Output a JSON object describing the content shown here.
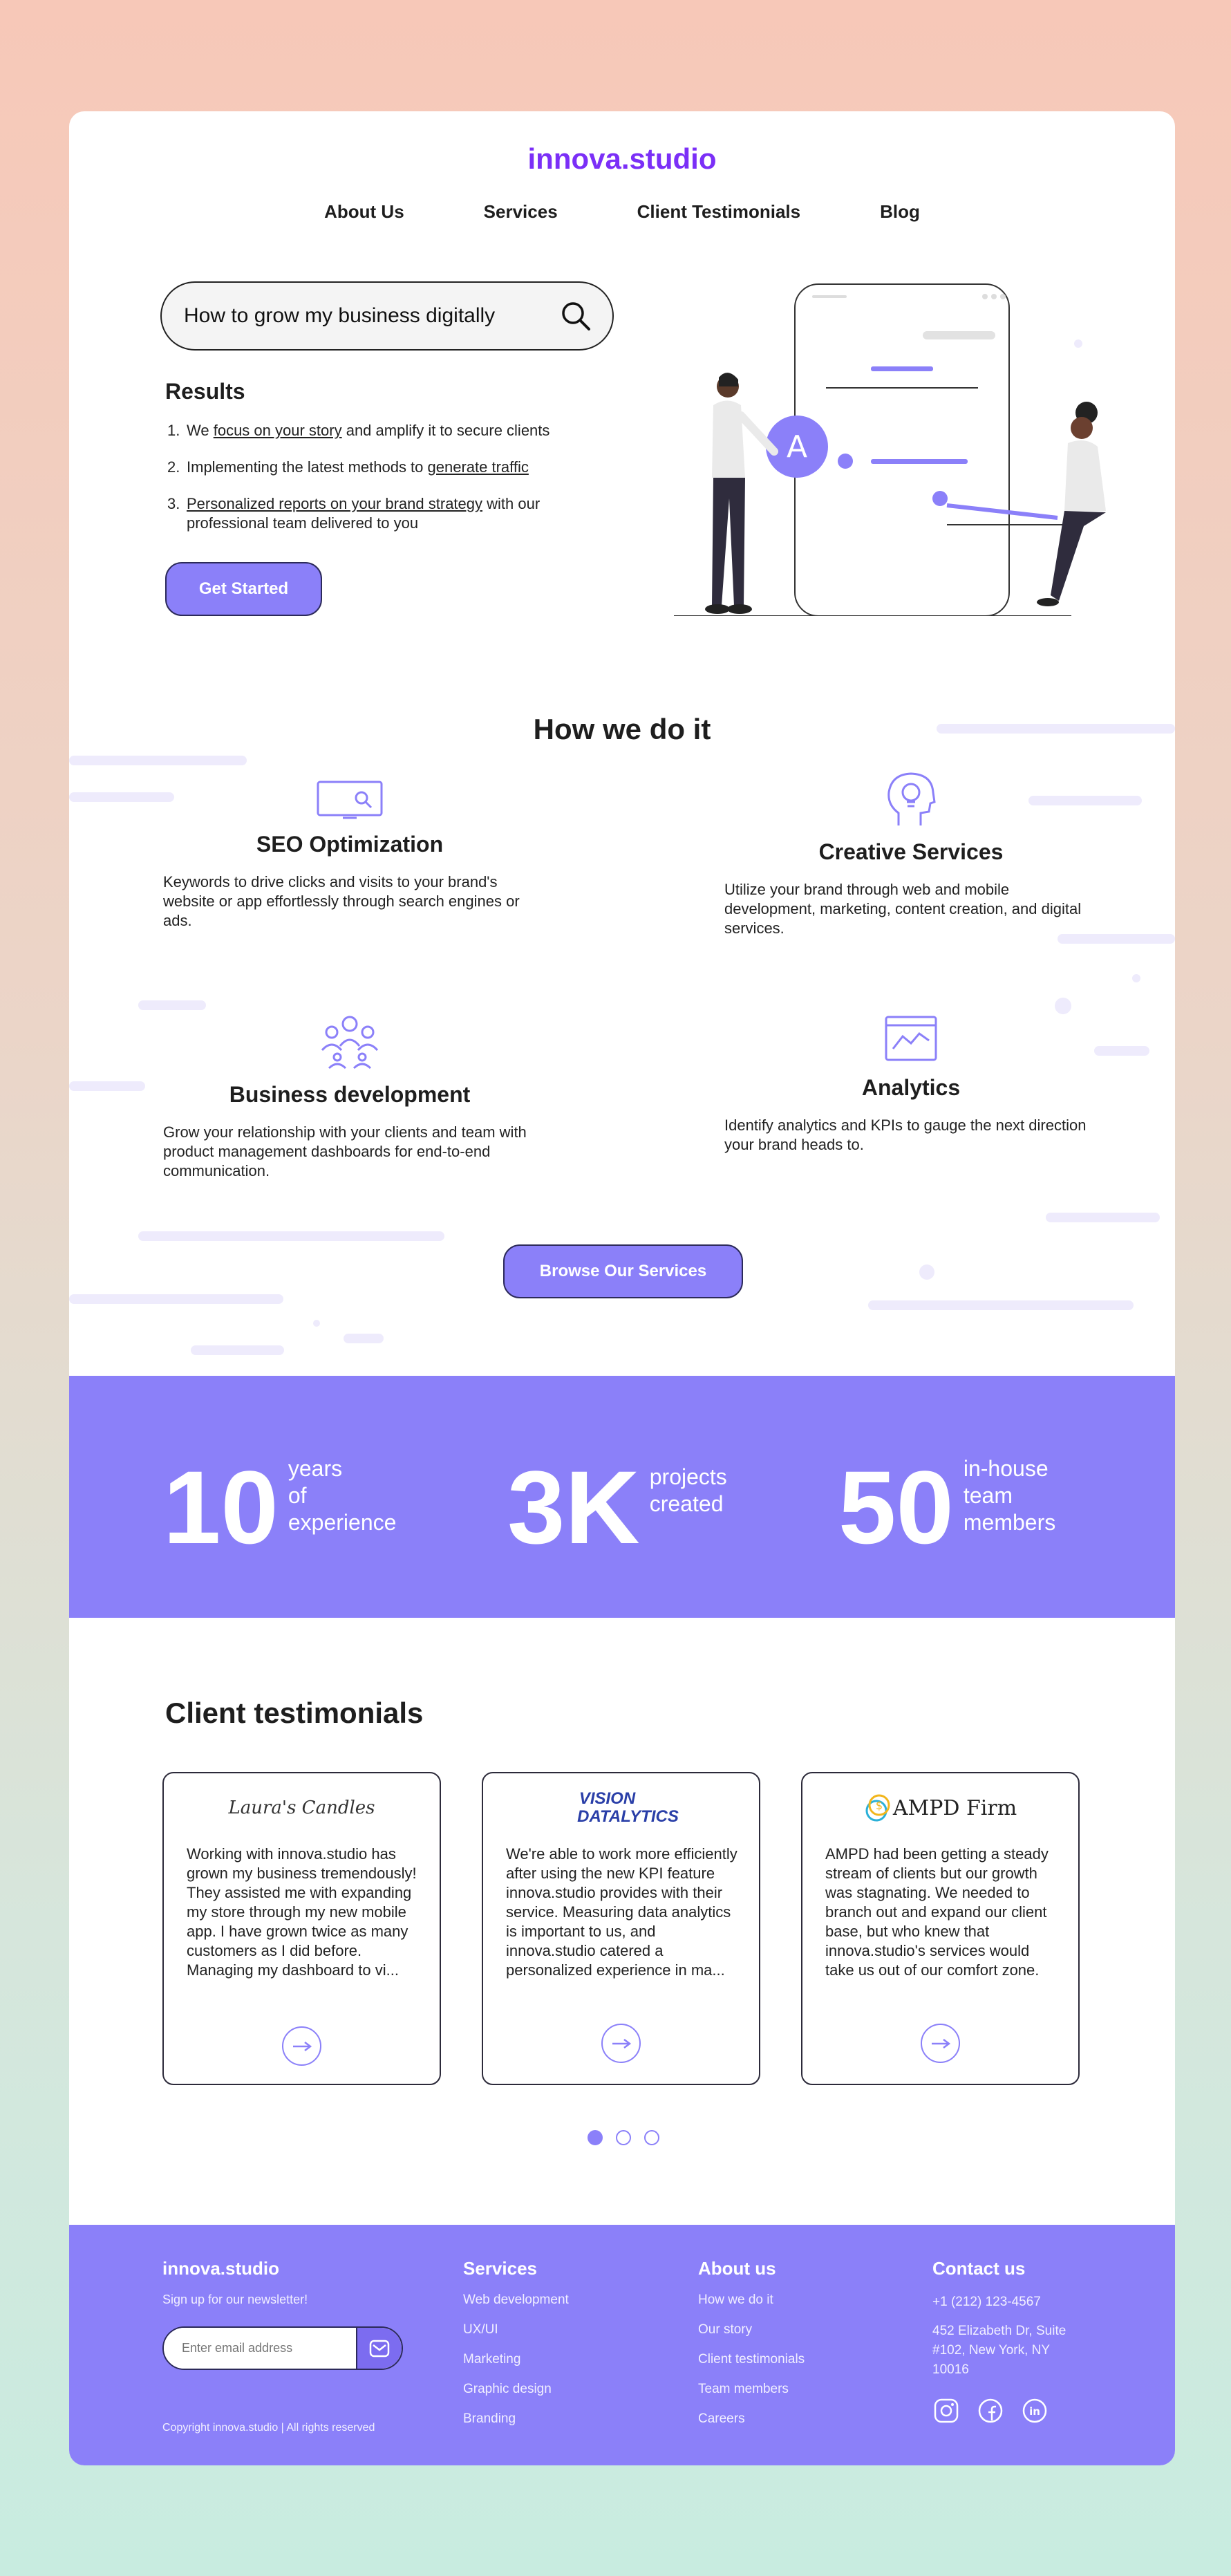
{
  "brand": {
    "logo": "innova.studio",
    "accent": "#7b2ff7",
    "primary": "#8b80f9"
  },
  "nav": {
    "items": [
      "About Us",
      "Services",
      "Client Testimonials",
      "Blog"
    ]
  },
  "search": {
    "value": "How to grow my business digitally",
    "icon": "search-icon"
  },
  "results": {
    "title": "Results",
    "items": [
      {
        "num": "1.",
        "pre": "We ",
        "link": "focus on your story",
        "post": " and amplify it to secure clients"
      },
      {
        "num": "2.",
        "pre": "Implementing the latest methods to ",
        "link": "generate traffic",
        "post": ""
      },
      {
        "num": "3.",
        "pre": "",
        "link": "Personalized reports on your brand strategy",
        "post": " with our professional team delivered to you"
      }
    ],
    "cta": "Get Started"
  },
  "how": {
    "title": "How we do it",
    "services": [
      {
        "icon": "search-window-icon",
        "title": "SEO Optimization",
        "desc": "Keywords to drive clicks and visits to your brand's website or app effortlessly through search engines or ads."
      },
      {
        "icon": "lightbulb-head-icon",
        "title": "Creative Services",
        "desc": "Utilize your brand through web and mobile development, marketing, content creation, and digital services."
      },
      {
        "icon": "team-icon",
        "title": "Business development",
        "desc": "Grow your relationship with your clients and team with product management dashboards for end-to-end communication."
      },
      {
        "icon": "analytics-chart-icon",
        "title": "Analytics",
        "desc": "Identify analytics and KPIs to gauge the next direction your brand heads to."
      }
    ],
    "cta": "Browse Our Services"
  },
  "stats": [
    {
      "num": "10",
      "l1": "years",
      "l2": "of",
      "l3": "experience"
    },
    {
      "num": "3K",
      "l1": "projects",
      "l2": "created",
      "l3": ""
    },
    {
      "num": "50",
      "l1": "in-house",
      "l2": "team",
      "l3": "members"
    }
  ],
  "testimonials": {
    "title": "Client testimonials",
    "items": [
      {
        "brand": "Laura's Candles",
        "quote": "Working with innova.studio has grown my business tremendously! They assisted me with expanding my store through my new mobile app. I have grown twice as many customers as I did before. Managing my dashboard to vi..."
      },
      {
        "brand_l1": "VISION",
        "brand_l2": "DATALYTICS",
        "quote": "We're able to work more efficiently after using the new KPI feature innova.studio provides with their service. Measuring data analytics is important to us, and innova.studio catered a personalized experience in ma..."
      },
      {
        "brand": "AMPD Firm",
        "quote": "AMPD had been getting a steady stream of clients but our growth was stagnating. We needed to branch out and expand our client base, but who knew that innova.studio's services would take us out of our comfort zone."
      }
    ]
  },
  "footer": {
    "brand": "innova.studio",
    "newsletter": "Sign up for our newsletter!",
    "email_placeholder": "Enter email address",
    "copyright": "Copyright innova.studio | All rights reserved",
    "services": {
      "title": "Services",
      "links": [
        "Web development",
        "UX/UI",
        "Marketing",
        "Graphic design",
        "Branding"
      ]
    },
    "about": {
      "title": "About us",
      "links": [
        "How we do it",
        "Our story",
        "Client testimonials",
        "Team members",
        "Careers"
      ]
    },
    "contact": {
      "title": "Contact us",
      "phone": "+1 (212) 123-4567",
      "addr1": "452 Elizabeth Dr, Suite",
      "addr2": "#102, New York, NY",
      "addr3": "10016",
      "social": [
        "instagram-icon",
        "facebook-icon",
        "linkedin-icon"
      ]
    }
  }
}
